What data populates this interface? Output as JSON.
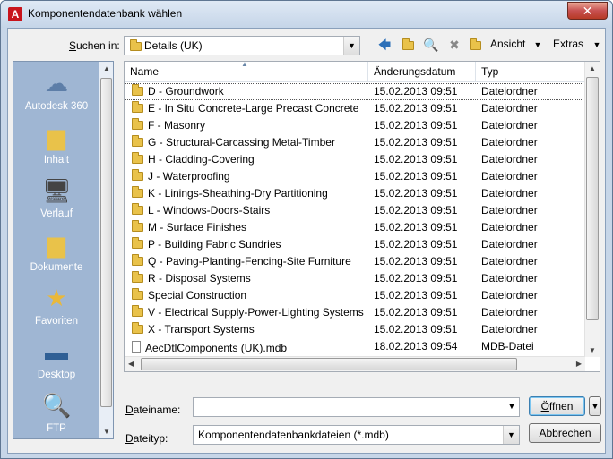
{
  "window": {
    "title": "Komponentendatenbank wählen",
    "close_glyph": "✕",
    "app_glyph": "A"
  },
  "lookin": {
    "label_prefix": "S",
    "label_rest": "uchen in:",
    "value": "Details (UK)"
  },
  "toolbar": {
    "back_icon": "🡄",
    "view_label": "Ansicht",
    "tools_label": "Extras"
  },
  "places": [
    {
      "label": "Autodesk 360",
      "icon": "cloud-icon"
    },
    {
      "label": "Inhalt",
      "icon": "folder-icon"
    },
    {
      "label": "Verlauf",
      "icon": "history-icon"
    },
    {
      "label": "Dokumente",
      "icon": "documents-icon"
    },
    {
      "label": "Favoriten",
      "icon": "favorites-icon"
    },
    {
      "label": "Desktop",
      "icon": "desktop-icon"
    },
    {
      "label": "FTP",
      "icon": "ftp-icon"
    }
  ],
  "columns": {
    "name": "Name",
    "date": "Änderungsdatum",
    "type": "Typ"
  },
  "files": [
    {
      "name": "D - Groundwork",
      "date": "15.02.2013 09:51",
      "type": "Dateiordner",
      "kind": "folder"
    },
    {
      "name": "E - In Situ Concrete-Large Precast Concrete",
      "date": "15.02.2013 09:51",
      "type": "Dateiordner",
      "kind": "folder"
    },
    {
      "name": "F - Masonry",
      "date": "15.02.2013 09:51",
      "type": "Dateiordner",
      "kind": "folder"
    },
    {
      "name": "G - Structural-Carcassing Metal-Timber",
      "date": "15.02.2013 09:51",
      "type": "Dateiordner",
      "kind": "folder"
    },
    {
      "name": "H - Cladding-Covering",
      "date": "15.02.2013 09:51",
      "type": "Dateiordner",
      "kind": "folder"
    },
    {
      "name": "J - Waterproofing",
      "date": "15.02.2013 09:51",
      "type": "Dateiordner",
      "kind": "folder"
    },
    {
      "name": "K - Linings-Sheathing-Dry Partitioning",
      "date": "15.02.2013 09:51",
      "type": "Dateiordner",
      "kind": "folder"
    },
    {
      "name": "L - Windows-Doors-Stairs",
      "date": "15.02.2013 09:51",
      "type": "Dateiordner",
      "kind": "folder"
    },
    {
      "name": "M - Surface Finishes",
      "date": "15.02.2013 09:51",
      "type": "Dateiordner",
      "kind": "folder"
    },
    {
      "name": "P - Building Fabric Sundries",
      "date": "15.02.2013 09:51",
      "type": "Dateiordner",
      "kind": "folder"
    },
    {
      "name": "Q - Paving-Planting-Fencing-Site Furniture",
      "date": "15.02.2013 09:51",
      "type": "Dateiordner",
      "kind": "folder"
    },
    {
      "name": "R - Disposal Systems",
      "date": "15.02.2013 09:51",
      "type": "Dateiordner",
      "kind": "folder"
    },
    {
      "name": "Special Construction",
      "date": "15.02.2013 09:51",
      "type": "Dateiordner",
      "kind": "folder"
    },
    {
      "name": "V - Electrical Supply-Power-Lighting Systems",
      "date": "15.02.2013 09:51",
      "type": "Dateiordner",
      "kind": "folder"
    },
    {
      "name": "X - Transport Systems",
      "date": "15.02.2013 09:51",
      "type": "Dateiordner",
      "kind": "folder"
    },
    {
      "name": "AecDtlComponents (UK).mdb",
      "date": "18.02.2013 09:54",
      "type": "MDB-Datei",
      "kind": "file"
    }
  ],
  "filename": {
    "label_prefix": "D",
    "label_rest": "ateiname:",
    "value": ""
  },
  "filetype": {
    "label_prefix": "D",
    "label_rest": "ateityp:",
    "value": "Komponentendatenbankdateien (*.mdb)"
  },
  "buttons": {
    "open_prefix": "Ö",
    "open_rest": "ffnen",
    "cancel": "Abbrechen"
  }
}
